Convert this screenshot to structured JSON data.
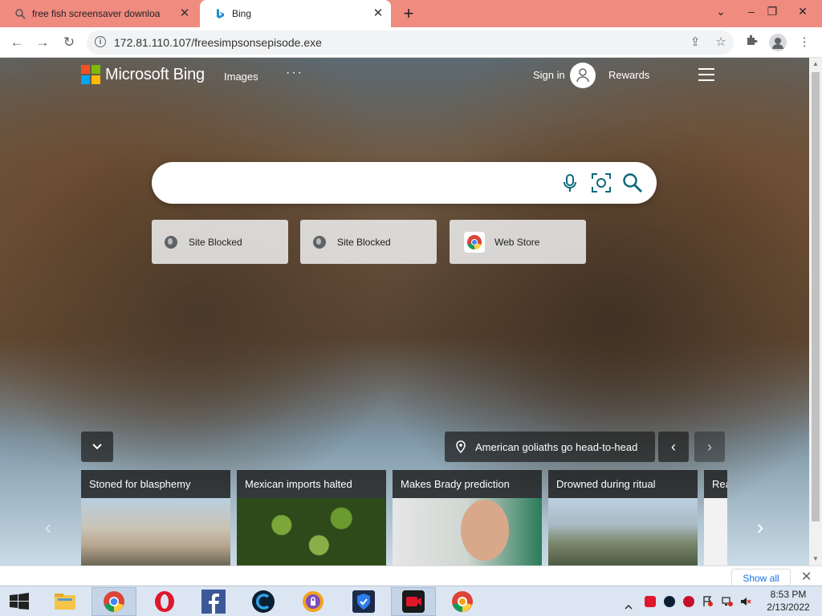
{
  "browser": {
    "tabs": [
      {
        "title": "free fish screensaver downloa",
        "active": false
      },
      {
        "title": "Bing",
        "active": true
      }
    ],
    "new_tab_glyph": "+",
    "window_controls": [
      "chevron-down-icon",
      "minimize-icon",
      "restore-icon",
      "close-icon"
    ],
    "address": {
      "url": "172.81.110.107/freesimpsonsepisode.exe"
    }
  },
  "bing": {
    "brand": "Microsoft Bing",
    "nav_images": "Images",
    "nav_more": "···",
    "sign_in": "Sign in",
    "rewards": "Rewards",
    "search": {
      "value": "",
      "placeholder": ""
    },
    "quick_links": [
      {
        "label": "Site Blocked",
        "icon": "globe-icon"
      },
      {
        "label": "Site Blocked",
        "icon": "globe-icon"
      },
      {
        "label": "Web Store",
        "icon": "chrome-icon"
      }
    ],
    "image_caption": "American goliaths go head-to-head",
    "news": [
      {
        "title": "Stoned for blasphemy"
      },
      {
        "title": "Mexican imports halted"
      },
      {
        "title": "Makes Brady prediction"
      },
      {
        "title": "Drowned during ritual"
      },
      {
        "title": "Rea"
      }
    ]
  },
  "downloads_bar": {
    "show_all": "Show all"
  },
  "taskbar": {
    "apps": [
      "windows-start-icon",
      "file-explorer-icon",
      "chrome-icon",
      "opera-icon",
      "facebook-icon",
      "ccleaner-icon",
      "vpn-icon",
      "shield-icon",
      "screen-recorder-icon",
      "chrome-vpn-icon"
    ],
    "time": "8:53 PM",
    "date": "2/13/2022"
  },
  "colors": {
    "tabstrip": "#f08b80",
    "accent_blue": "#1a73e8",
    "search_icon": "#0c6a7c"
  }
}
